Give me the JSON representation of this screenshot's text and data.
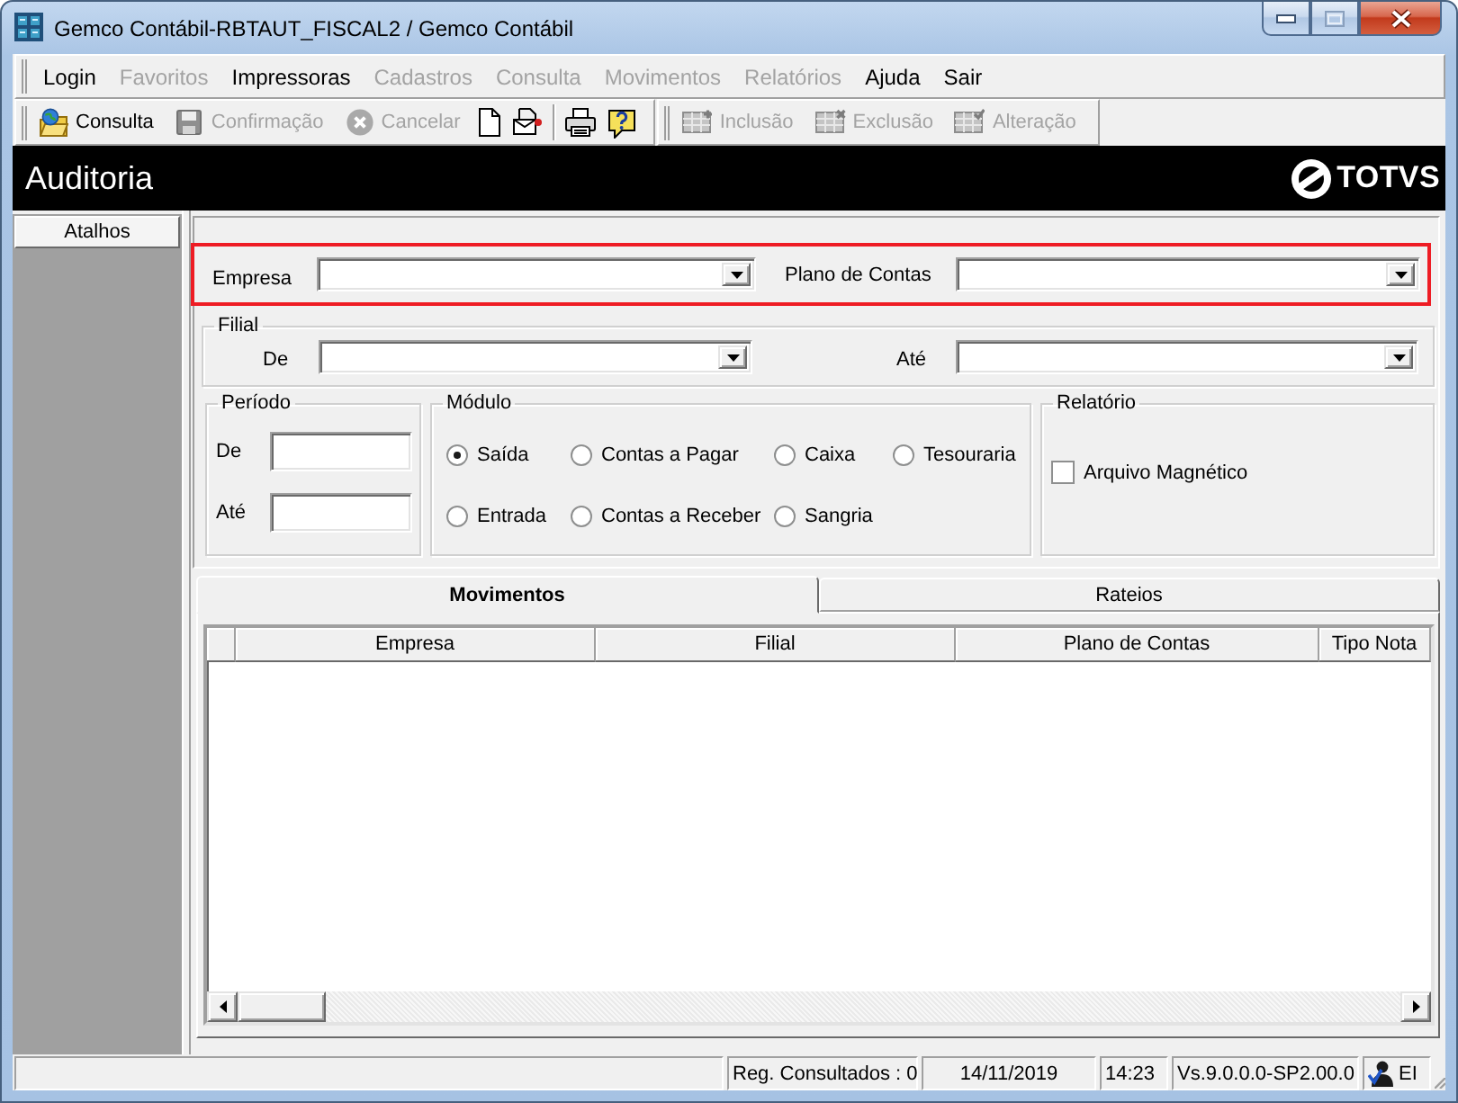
{
  "window": {
    "title": "Gemco Contábil-RBTAUT_FISCAL2 / Gemco Contábil"
  },
  "menu": [
    {
      "label": "Login",
      "disabled": false
    },
    {
      "label": "Favoritos",
      "disabled": true
    },
    {
      "label": "Impressoras",
      "disabled": false
    },
    {
      "label": "Cadastros",
      "disabled": true
    },
    {
      "label": "Consulta",
      "disabled": true
    },
    {
      "label": "Movimentos",
      "disabled": true
    },
    {
      "label": "Relatórios",
      "disabled": true
    },
    {
      "label": "Ajuda",
      "disabled": false
    },
    {
      "label": "Sair",
      "disabled": false
    }
  ],
  "toolbars": [
    {
      "items": [
        {
          "kind": "labeled",
          "label": "Consulta",
          "disabled": false
        },
        {
          "kind": "labeled",
          "label": "Confirmação",
          "disabled": true
        },
        {
          "kind": "labeled",
          "label": "Cancelar",
          "disabled": true
        },
        {
          "kind": "icon",
          "disabled": false
        },
        {
          "kind": "icon",
          "disabled": false
        },
        {
          "kind": "separator"
        },
        {
          "kind": "icon",
          "disabled": false
        },
        {
          "kind": "icon",
          "disabled": false
        }
      ]
    },
    {
      "items": [
        {
          "kind": "labeled",
          "label": "Inclusão",
          "disabled": true
        },
        {
          "kind": "labeled",
          "label": "Exclusão",
          "disabled": true
        },
        {
          "kind": "labeled",
          "label": "Alteração",
          "disabled": true
        }
      ]
    }
  ],
  "header": {
    "title": "Auditoria",
    "logo_text": "TOTVS"
  },
  "sidebar": {
    "button": "Atalhos"
  },
  "company_filter": {
    "highlighted": true,
    "fields": [
      {
        "label": "Empresa"
      },
      {
        "label": "Plano de Contas"
      }
    ]
  },
  "branch_filter": {
    "title": "Filial",
    "fields": [
      {
        "label": "De"
      },
      {
        "label": "Até"
      }
    ]
  },
  "period": {
    "title": "Período",
    "fields": [
      {
        "label": "De"
      },
      {
        "label": "Até"
      }
    ]
  },
  "module": {
    "title": "Módulo",
    "options": [
      {
        "label": "Saída",
        "selected": true
      },
      {
        "label": "Contas a Pagar",
        "selected": false
      },
      {
        "label": "Caixa",
        "selected": false
      },
      {
        "label": "Tesouraria",
        "selected": false
      },
      {
        "label": "Entrada",
        "selected": false
      },
      {
        "label": "Contas a Receber",
        "selected": false
      },
      {
        "label": "Sangria",
        "selected": false
      }
    ]
  },
  "report": {
    "title": "Relatório",
    "options": [
      {
        "label": "Arquivo Magnético",
        "checked": false
      }
    ]
  },
  "tabs": [
    {
      "label": "Movimentos",
      "selected": true
    },
    {
      "label": "Rateios",
      "selected": false
    }
  ],
  "grid": {
    "columns": [
      "Empresa",
      "Filial",
      "Plano de Contas",
      "Tipo Nota"
    ]
  },
  "status_bar": {
    "panels": [
      "Reg. Consultados : 0",
      "14/11/2019",
      "14:23",
      "Vs.9.0.0.0-SP2.00.0"
    ],
    "indicator": "EI"
  }
}
